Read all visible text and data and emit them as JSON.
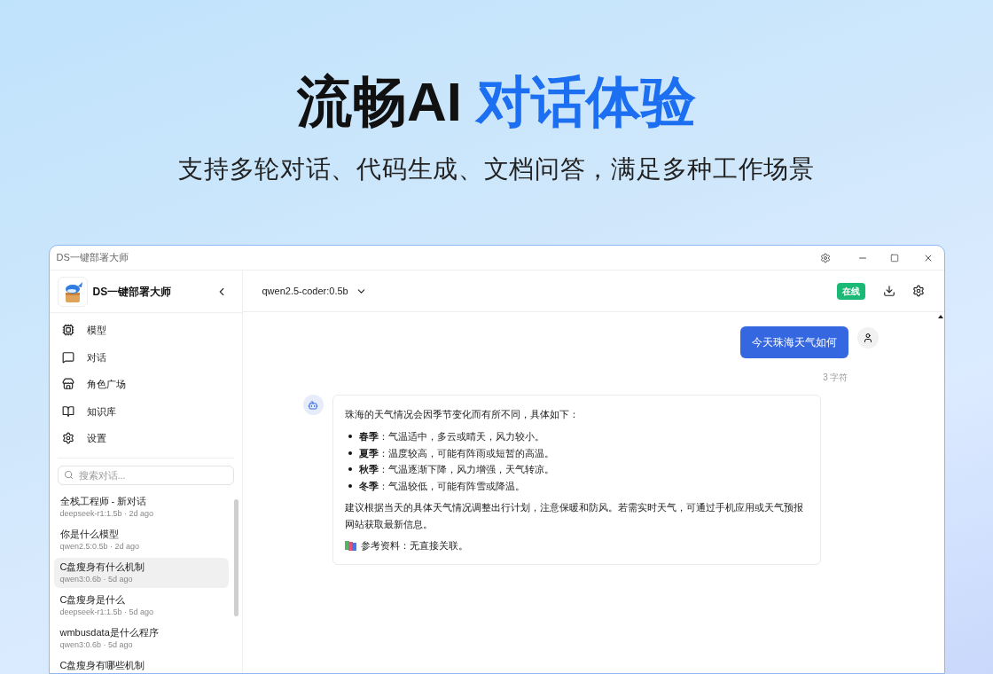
{
  "headline": {
    "text": "流畅AI",
    "highlight": "对话体验"
  },
  "subtitle": "支持多轮对话、代码生成、文档问答，满足多种工作场景",
  "window": {
    "title": "DS一键部署大师"
  },
  "sidebar": {
    "app_name": "DS一键部署大师",
    "nav": [
      {
        "label": "模型",
        "kind": "chip"
      },
      {
        "label": "对话",
        "kind": "chat"
      },
      {
        "label": "角色广场",
        "kind": "store"
      },
      {
        "label": "知识库",
        "kind": "book"
      },
      {
        "label": "设置",
        "kind": "gear"
      }
    ],
    "search": {
      "placeholder": "搜索对话..."
    },
    "chats": [
      {
        "title": "全栈工程师 - 新对话",
        "meta": "deepseek-r1:1.5b · 2d ago",
        "selected": false
      },
      {
        "title": "你是什么模型",
        "meta": "qwen2.5:0.5b · 2d ago",
        "selected": false
      },
      {
        "title": "C盘瘦身有什么机制",
        "meta": "qwen3:0.6b · 5d ago",
        "selected": true
      },
      {
        "title": "C盘瘦身是什么",
        "meta": "deepseek-r1:1.5b · 5d ago",
        "selected": false
      },
      {
        "title": "wmbusdata是什么程序",
        "meta": "qwen3:0.6b · 5d ago",
        "selected": false
      },
      {
        "title": "C盘瘦身有哪些机制",
        "selected": false
      }
    ]
  },
  "header": {
    "model": "qwen2.5-coder:0.5b",
    "status": "在线"
  },
  "messages": [
    {
      "kind": "user",
      "text": "今天珠海天气如何",
      "count": "3 字符"
    },
    {
      "kind": "assistant",
      "intro": "珠海的天气情况会因季节变化而有所不同，具体如下：",
      "bullets": [
        "**春季**：气温适中，多云或晴天，风力较小。",
        "**夏季**：温度较高，可能有阵雨或短暂的高温。",
        "**秋季**：气温逐渐下降，风力增强，天气转凉。",
        "**冬季**：气温较低，可能有阵雪或降温。"
      ],
      "advice": "建议根据当天的具体天气情况调整出行计划，注意保暖和防风。若需实时天气，可通过手机应用或天气预报网站获取最新信息。",
      "reference": "参考资料：无直接关联。"
    }
  ]
}
